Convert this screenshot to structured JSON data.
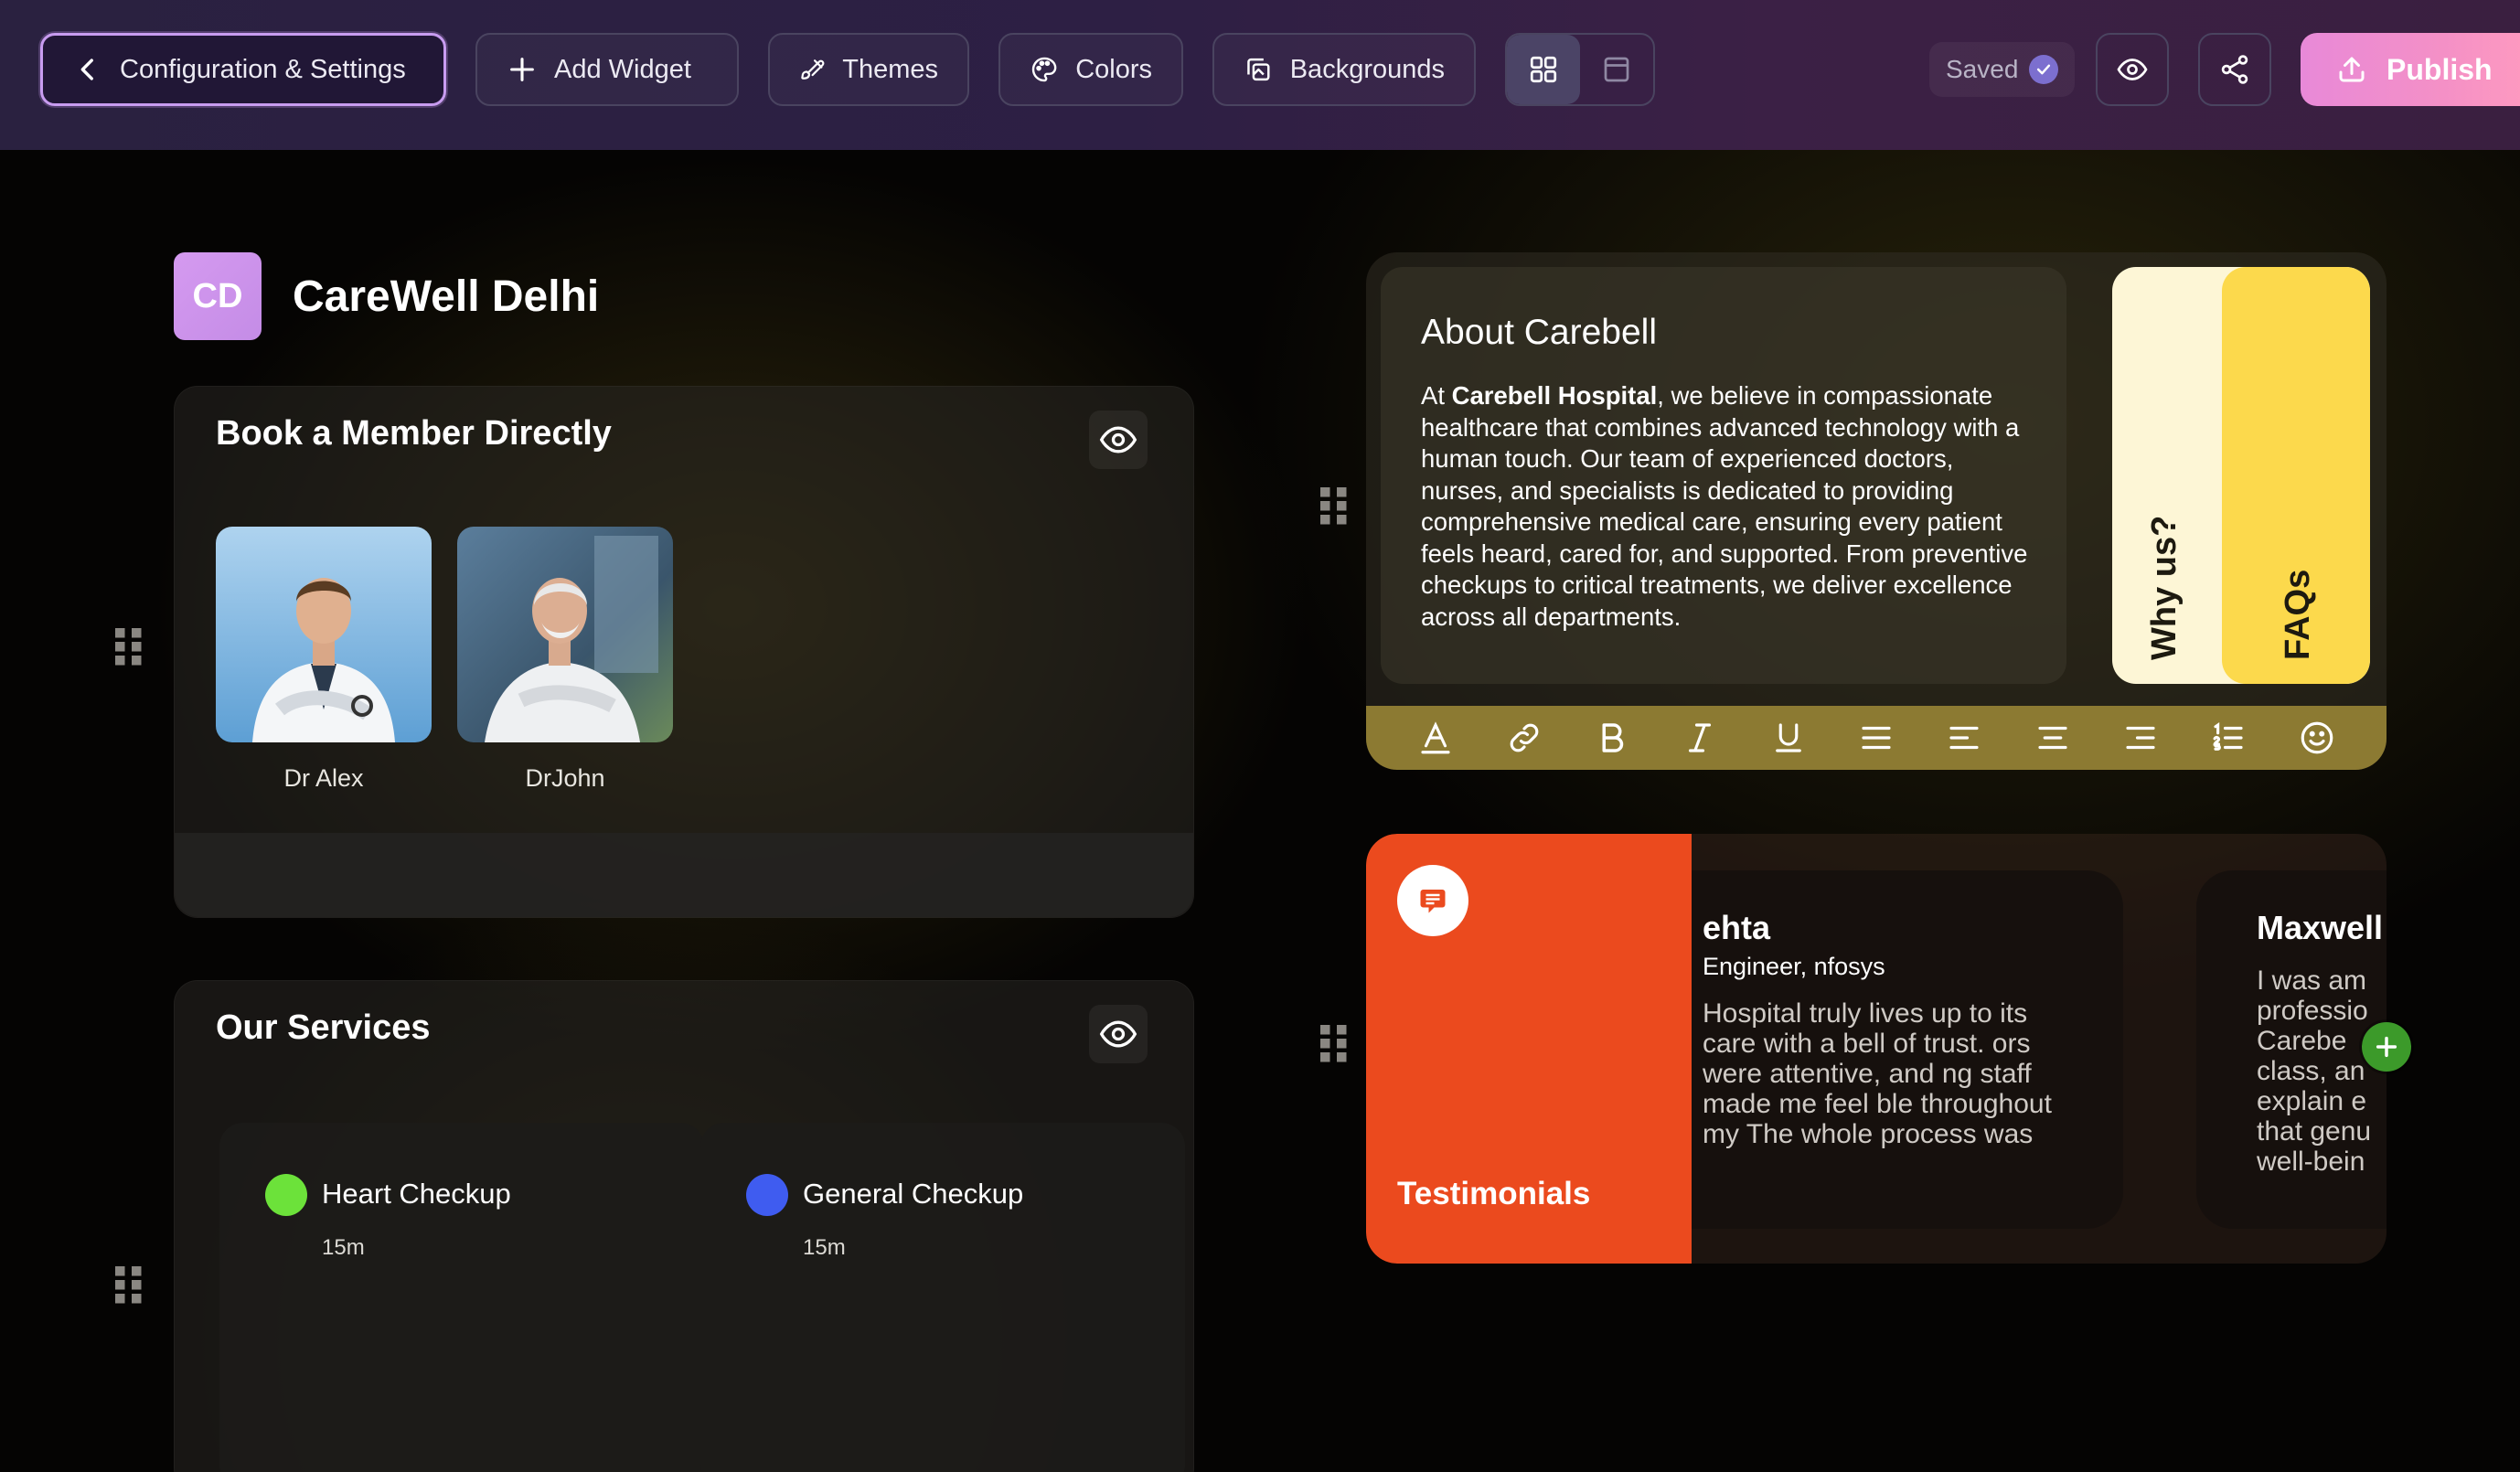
{
  "toolbar": {
    "config_label": "Configuration & Settings",
    "add_widget_label": "Add Widget",
    "themes_label": "Themes",
    "colors_label": "Colors",
    "backgrounds_label": "Backgrounds",
    "saved_label": "Saved",
    "publish_label": "Publish"
  },
  "brand": {
    "initials": "CD",
    "name": "CareWell Delhi"
  },
  "book_section": {
    "title": "Book a Member Directly",
    "doctors": [
      {
        "name": "Dr Alex"
      },
      {
        "name": "DrJohn"
      }
    ]
  },
  "services_section": {
    "title": "Our Services",
    "items": [
      {
        "name": "Heart Checkup",
        "duration": "15m",
        "color": "#6ce23a"
      },
      {
        "name": "General Checkup",
        "duration": "15m",
        "color": "#3f5cf0"
      }
    ]
  },
  "about": {
    "title": "About Carebell",
    "text_prefix": "At ",
    "text_bold": "Carebell Hospital",
    "text_rest": ", we believe in compassionate healthcare that combines advanced technology with a human touch. Our team of experienced doctors, nurses, and specialists is dedicated to providing comprehensive medical care, ensuring every patient feels heard, cared for, and supported. From preventive checkups to critical treatments, we deliver excellence across all departments.",
    "tabs": [
      "Why us?",
      "FAQs"
    ]
  },
  "testimonials": {
    "label": "Testimonials",
    "cards": [
      {
        "name": "ehta",
        "role": "Engineer, nfosys",
        "text": "Hospital truly lives up to its care with a bell of trust. ors were attentive, and ng staff made me feel ble throughout my The whole process was"
      },
      {
        "name": "Maxwell",
        "text": "I was am professio Carebe class, an explain e that genu well-bein"
      }
    ]
  },
  "colors": {
    "accent_purple": "#c89cf0",
    "publish_pink": "#f490c6",
    "testimonials_orange": "#eb4a1e",
    "faq_yellow": "#fcd94c",
    "why_cream": "#fdf6d6"
  }
}
